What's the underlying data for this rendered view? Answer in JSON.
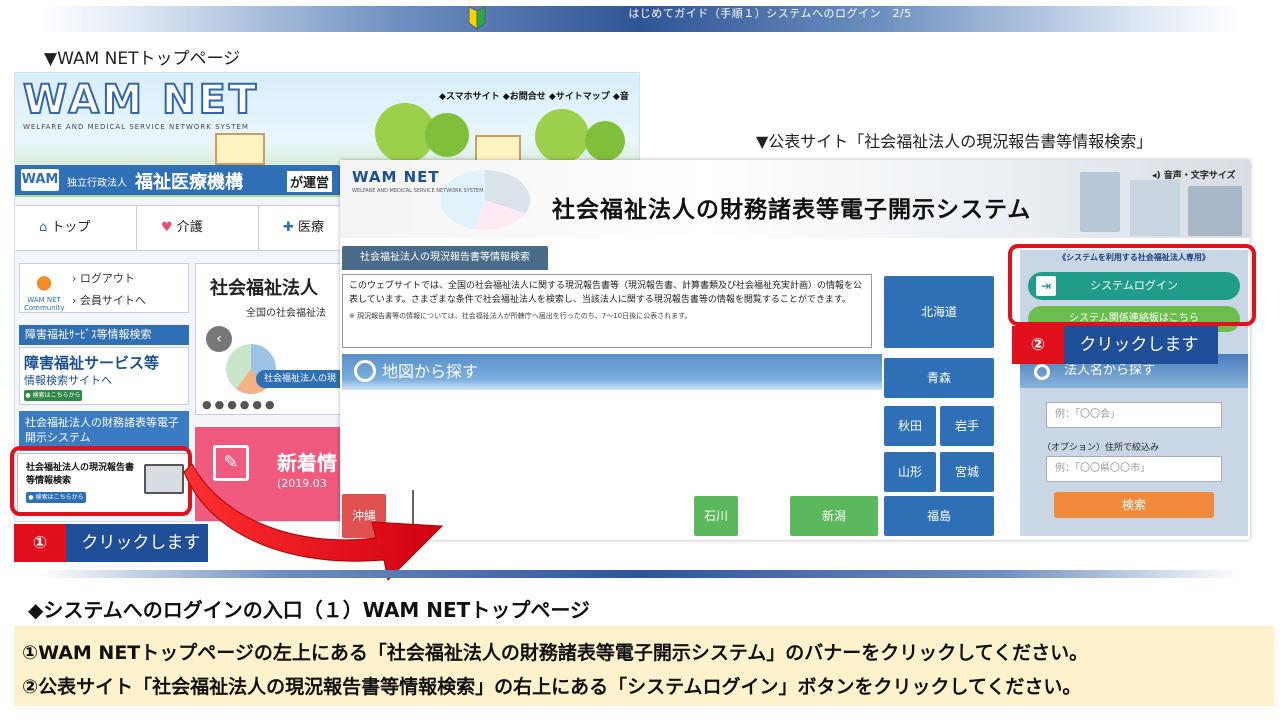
{
  "top_banner": {
    "title": "はじめてガイド（手順１）システムへのログイン　2/5"
  },
  "wam_section_label": "▼WAM  NETトップページ",
  "pub_section_label": "▼公表サイト「社会福祉法人の現況報告書等情報検索」",
  "wam": {
    "logo": "WAM NET",
    "logo_sub": "WELFARE AND MEDICAL SERVICE NETWORK SYSTEM",
    "top_links": "◆スマホサイト ◆お問合せ ◆サイトマップ ◆音",
    "org_logo": "WAM",
    "org_small": "独立行政法人",
    "org_big": "福祉医療機構",
    "org_tail": "が運営",
    "nav": [
      "トップ",
      "介護",
      "医療"
    ],
    "side": {
      "community": "WAM NET Community",
      "logout": "› ログアウト",
      "member": "› 会員サイトへ",
      "header1": "障害福祉ｻｰﾋﾞｽ等情報検索",
      "banner1_title": "障害福祉サービス等",
      "banner1_sub": "情報検索サイトへ",
      "banner1_btn": "● 検索はこちらから",
      "banner2": "社会福祉法人の財務諸表等電子開示システム",
      "banner3_title": "社会福祉法人の現況報告書等情報検索",
      "banner3_btn": "● 検索はこちらから"
    },
    "slider": {
      "title": "社会福祉法人",
      "sub": "全国の社会福祉法",
      "tag": "社会福祉法人の現",
      "prev": "‹",
      "dots": "●●●●●●"
    },
    "news": {
      "title": "新着情",
      "date": "(2019.03"
    }
  },
  "click1": {
    "num": "①",
    "label": "クリックします"
  },
  "click2": {
    "num": "②",
    "label": "クリックします"
  },
  "pub": {
    "logo": "WAM NET",
    "logo_sub": "WELFARE AND MEDICAL SERVICE NETWORK SYSTEM",
    "title": "社会福祉法人の財務諸表等電子開示システム",
    "voice": "◂) 音声・文字サイズ",
    "tab": "社会福祉法人の現況報告書等情報検索",
    "notice": "このウェブサイトでは、全国の社会福祉法人に関する現況報告書等（現況報告書、計算書類及び社会福祉充実計画）の情報を公表しています。さまざまな条件で社会福祉法人を検索し、当該法人に関する現況報告書等の情報を閲覧することができます。",
    "notice_note": "※ 現況報告書等の情報については、社会福祉法人が所轄庁へ届出を行ったのち、7～10日後に公表されます。",
    "map_header": "地図から探す",
    "prefs": {
      "hokkaido": "北海道",
      "aomori": "青森",
      "akita": "秋田",
      "iwate": "岩手",
      "yamagata": "山形",
      "miyagi": "宮城",
      "fukushima": "福島",
      "niigata": "新潟",
      "ishikawa": "石川",
      "okinawa": "沖縄"
    },
    "right_header": "《システムを利用する社会福祉法人専用》",
    "login_btn": "システムログイン",
    "login_icon": "⇥",
    "board_btn": "システム関係連絡板はこちら",
    "corp_header": "法人名から探す",
    "corp_placeholder": "例：「〇〇会」",
    "addr_label": "（オプション）住所で絞込み",
    "addr_placeholder": "例：「〇〇県〇〇市」",
    "search_btn": "検索"
  },
  "heading": "◆システムへのログインの入口（１）WAM NETトップページ",
  "instructions": [
    "①WAM NETトップページの左上にある「社会福祉法人の財務諸表等電子開示システム」のバナーをクリックしてください。",
    "②公表サイト「社会福祉法人の現況報告書等情報検索」の右上にある「システムログイン」ボタンをクリックしてください。"
  ]
}
